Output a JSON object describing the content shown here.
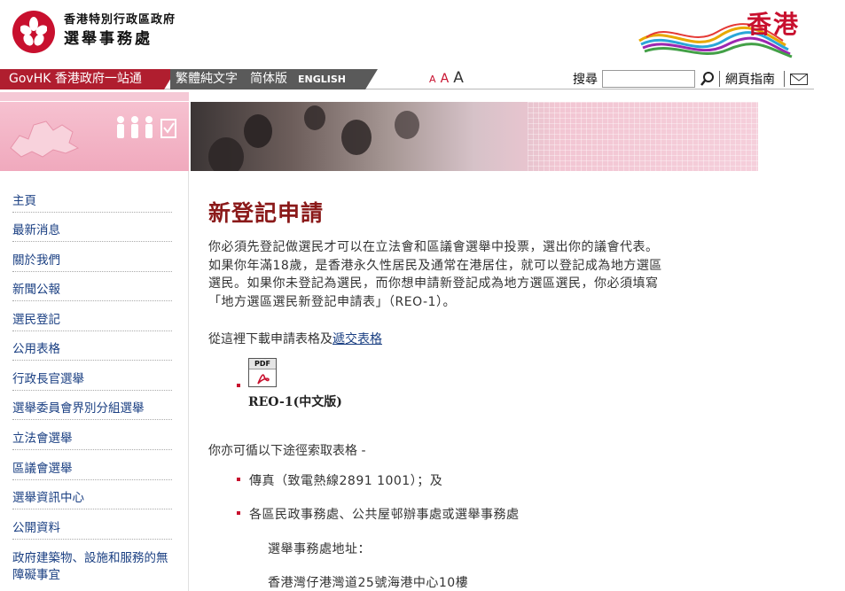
{
  "header": {
    "dept_line1": "香港特別行政區政府",
    "dept_line2": "選舉事務處",
    "brand": "香港"
  },
  "navbar": {
    "govhk": "GovHK 香港政府一站通",
    "lang_trad": "繁體純文字",
    "lang_simp": "简体版",
    "lang_en": "ENGLISH",
    "font_small": "A",
    "font_medium": "A",
    "font_large": "A",
    "search_label": "搜尋",
    "search_value": "",
    "site_guide": "網頁指南"
  },
  "sidebar": {
    "items": [
      {
        "label": "主頁"
      },
      {
        "label": "最新消息"
      },
      {
        "label": "關於我們"
      },
      {
        "label": "新聞公報"
      },
      {
        "label": "選民登記"
      },
      {
        "label": "公用表格"
      },
      {
        "label": "行政長官選舉"
      },
      {
        "label": "選舉委員會界別分組選舉"
      },
      {
        "label": "立法會選舉"
      },
      {
        "label": "區議會選舉"
      },
      {
        "label": "選舉資訊中心"
      },
      {
        "label": "公開資料"
      },
      {
        "label": "政府建築物、設施和服務的無障礙事宜"
      }
    ]
  },
  "main": {
    "title": "新登記申請",
    "intro_line1": "你必須先登記做選民才可以在立法會和區議會選舉中投票，選出你的議會代表。",
    "intro_line2": "如果你年滿18歲，是香港永久性居民及通常在港居住，就可以登記成為地方選區",
    "intro_line3": "選民。如果你未登記為選民，而你想申請新登記成為地方選區選民，你必須填寫",
    "intro_line4": "「地方選區選民新登記申請表」（REO-1）。",
    "download_prefix": "從這裡下載申請表格及",
    "download_link": "遞交表格",
    "pdf_badge": "PDF",
    "form_label": "REO-1(中文版)",
    "alt_text": "你亦可循以下途徑索取表格 -",
    "list_fax": "傳真（致電熱線2891 1001）；及",
    "list_offices": "各區民政事務處、公共屋邨辦事處或選舉事務處",
    "office_heading": "選舉事務處地址：",
    "office_address": "香港灣仔港灣道25號海港中心10樓"
  },
  "colors": {
    "accent_red": "#c8102e",
    "govhk_red": "#b01e2f",
    "link_blue": "#1a3f82",
    "title_red": "#8b1a1a",
    "banner_pink": "#f5c9d6"
  }
}
